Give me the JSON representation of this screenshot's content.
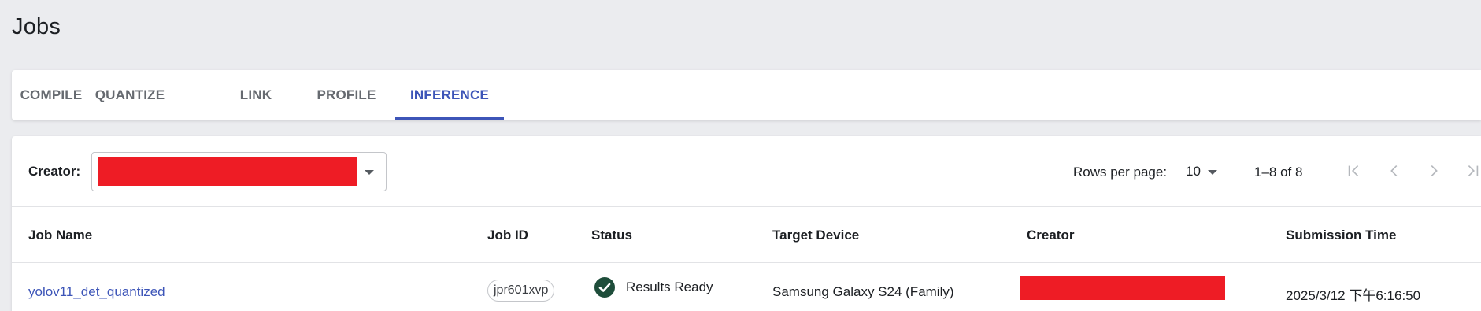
{
  "page": {
    "title": "Jobs"
  },
  "tabs": [
    {
      "label": "COMPILE",
      "active": false
    },
    {
      "label": "QUANTIZE",
      "active": false
    },
    {
      "label": "LINK",
      "active": false
    },
    {
      "label": "PROFILE",
      "active": false
    },
    {
      "label": "INFERENCE",
      "active": true
    }
  ],
  "filter": {
    "creator_label": "Creator:",
    "creator_value_redacted": true
  },
  "pagination": {
    "rows_per_page_label": "Rows per page:",
    "rows_per_page_value": "10",
    "range_text": "1–8 of 8",
    "icons": [
      "first-page-icon",
      "previous-page-icon",
      "next-page-icon",
      "last-page-icon"
    ]
  },
  "table": {
    "columns": [
      "Job Name",
      "Job ID",
      "Status",
      "Target Device",
      "Creator",
      "Submission Time"
    ],
    "rows": [
      {
        "job_name": "yolov11_det_quantized",
        "job_id": "jpr601xvp",
        "status": "Results Ready",
        "status_icon": "check-circle-icon",
        "target_device": "Samsung Galaxy S24 (Family)",
        "creator_redacted": true,
        "submission_time": "2025/3/12 下午6:16:50"
      }
    ]
  },
  "colors": {
    "accent": "#3d55b8",
    "redaction": "#ee1c25",
    "status_ok": "#1e4d3a",
    "background": "#ebecef"
  }
}
